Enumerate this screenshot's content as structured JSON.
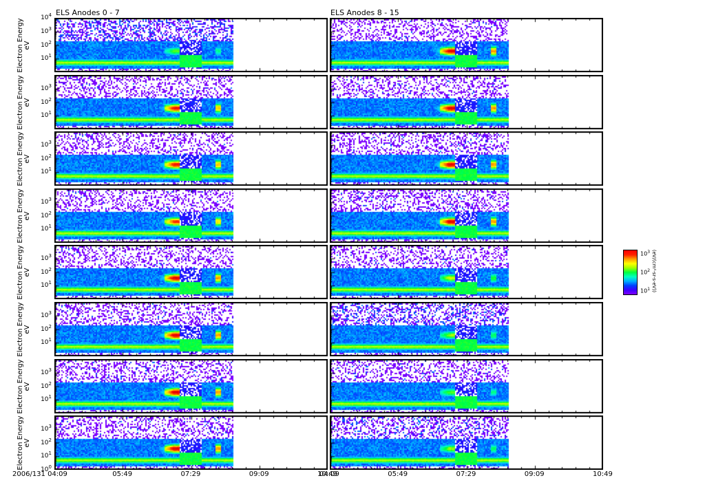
{
  "chart_data": {
    "type": "heatmap",
    "titles": [
      "ELS Anodes 0 - 7",
      "ELS Anodes 8 - 15"
    ],
    "ylabel": [
      "Electron Energy",
      "eV"
    ],
    "yscale": "log",
    "ylim": [
      1,
      10000
    ],
    "ytick_labels": {
      "10^0": "10",
      "10^1": "10",
      "10^2": "10",
      "10^3": "10",
      "10^4": "10"
    },
    "x_start_label": "2006/131 04:09",
    "x_tick_labels": [
      "04:09",
      "05:49",
      "07:29",
      "09:09",
      "10:49"
    ],
    "x_range_minutes": [
      0,
      400
    ],
    "data_end_minute": 261,
    "event_minute": 174,
    "second_event_minute": 238,
    "colorbar": {
      "tick_labels": [
        "10",
        "10",
        "10"
      ],
      "tick_exponents": [
        "3",
        "2",
        "1"
      ],
      "label": "(eV/(cm²-sr-s-eV))"
    },
    "columns": [
      {
        "panels": [
          {
            "anode": 0,
            "noise": 0.9,
            "peak": 0.55
          },
          {
            "anode": 1,
            "noise": 0.1,
            "peak": 0.95
          },
          {
            "anode": 2,
            "noise": 0.1,
            "peak": 0.95
          },
          {
            "anode": 3,
            "noise": 0.1,
            "peak": 0.9
          },
          {
            "anode": 4,
            "noise": 0.1,
            "peak": 1.0
          },
          {
            "anode": 5,
            "noise": 0.15,
            "peak": 1.0
          },
          {
            "anode": 6,
            "noise": 0.25,
            "peak": 1.0
          },
          {
            "anode": 7,
            "noise": 0.15,
            "peak": 1.0
          }
        ]
      },
      {
        "panels": [
          {
            "anode": 8,
            "noise": 0.1,
            "peak": 1.0
          },
          {
            "anode": 9,
            "noise": 0.15,
            "peak": 1.0
          },
          {
            "anode": 10,
            "noise": 0.15,
            "peak": 1.0
          },
          {
            "anode": 11,
            "noise": 0.15,
            "peak": 1.0
          },
          {
            "anode": 12,
            "noise": 0.15,
            "peak": 0.65
          },
          {
            "anode": 13,
            "noise": 0.9,
            "peak": 0.6
          },
          {
            "anode": 14,
            "noise": 0.2,
            "peak": 0.55
          },
          {
            "anode": 15,
            "noise": 0.6,
            "peak": 0.6
          }
        ]
      }
    ]
  }
}
